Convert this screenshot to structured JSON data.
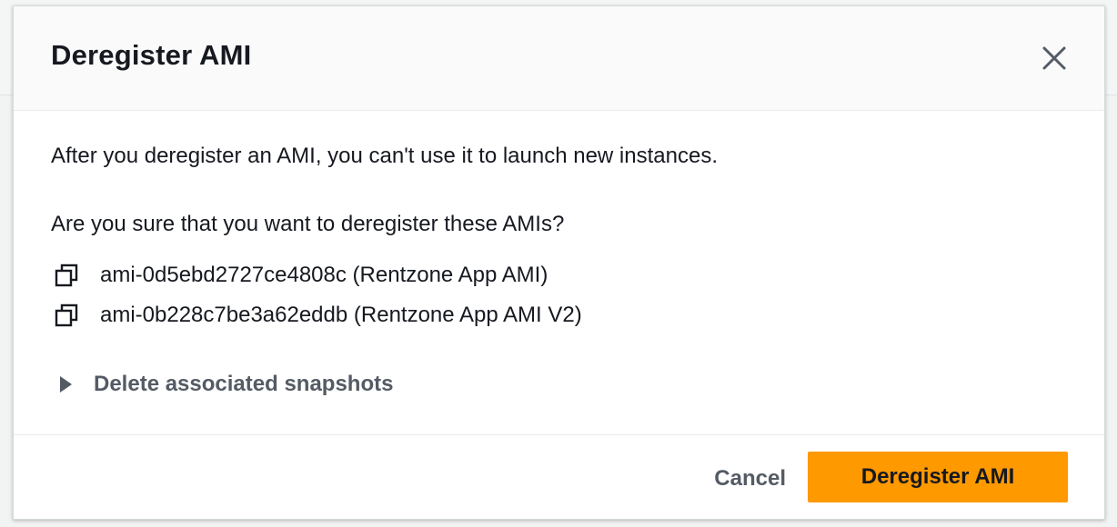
{
  "modal": {
    "title": "Deregister AMI",
    "close_icon": "close-icon",
    "warning_text": "After you deregister an AMI, you can't use it to launch new instances.",
    "confirm_question": "Are you sure that you want to deregister these AMIs?",
    "amis": [
      {
        "label": "ami-0d5ebd2727ce4808c (Rentzone App AMI)",
        "icon": "copy-icon"
      },
      {
        "label": "ami-0b228c7be3a62eddb (Rentzone App AMI V2)",
        "icon": "copy-icon"
      }
    ],
    "expander_label": "Delete associated snapshots",
    "expander_icon": "caret-right-icon",
    "cancel_label": "Cancel",
    "confirm_label": "Deregister AMI"
  },
  "colors": {
    "primary": "#ff9900",
    "text": "#16191f",
    "muted": "#545b64",
    "header_bg": "#fafafa"
  }
}
